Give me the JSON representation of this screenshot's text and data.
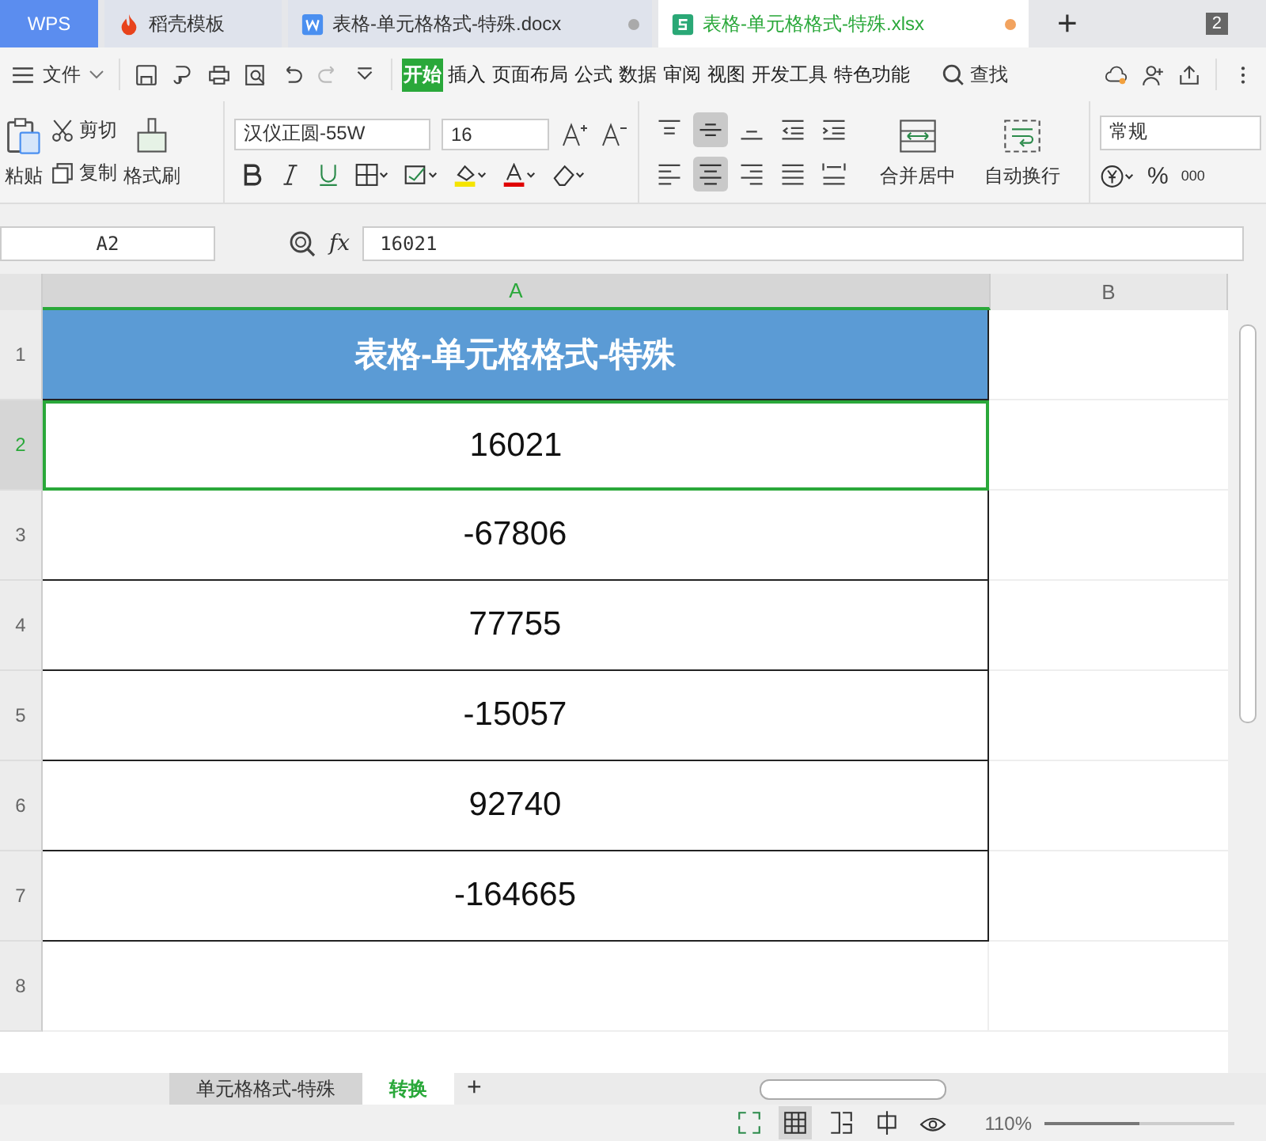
{
  "tabs": [
    {
      "label": "WPS",
      "kind": "app",
      "selected": false
    },
    {
      "label": "稻壳模板",
      "kind": "template",
      "selected": false
    },
    {
      "label": "表格-单元格格式-特殊.docx",
      "kind": "doc",
      "selected": false
    },
    {
      "label": "表格-单元格格式-特殊.xlsx",
      "kind": "sheet",
      "selected": true
    }
  ],
  "new_tab": "+",
  "window_count": "2",
  "menu": {
    "file": "文件",
    "items": [
      {
        "label": "开始",
        "selected": true
      },
      {
        "label": "插入",
        "selected": false
      },
      {
        "label": "页面布局",
        "selected": false
      },
      {
        "label": "公式",
        "selected": false
      },
      {
        "label": "数据",
        "selected": false
      },
      {
        "label": "审阅",
        "selected": false
      },
      {
        "label": "视图",
        "selected": false
      },
      {
        "label": "开发工具",
        "selected": false
      },
      {
        "label": "特色功能",
        "selected": false
      }
    ],
    "search": "查找"
  },
  "ribbon": {
    "paste": "粘贴",
    "cut": "剪切",
    "copy": "复制",
    "format_painter": "格式刷",
    "font": "汉仪正圆-55W",
    "size": "16",
    "merge": "合并居中",
    "wrap": "自动换行",
    "number_format": "常规",
    "number_glyphs": [
      "%",
      "000"
    ]
  },
  "name_box": "A2",
  "formula": "16021",
  "fx": "fx",
  "columns": [
    {
      "label": "A",
      "selected": true
    },
    {
      "label": "B",
      "selected": false
    }
  ],
  "rows": [
    {
      "num": "1",
      "value": "表格-单元格格式-特殊",
      "kind": "header",
      "selected": false
    },
    {
      "num": "2",
      "value": "16021",
      "kind": "value",
      "selected": true
    },
    {
      "num": "3",
      "value": "-67806",
      "kind": "value",
      "selected": false
    },
    {
      "num": "4",
      "value": "77755",
      "kind": "value",
      "selected": false
    },
    {
      "num": "5",
      "value": "-15057",
      "kind": "value",
      "selected": false
    },
    {
      "num": "6",
      "value": "92740",
      "kind": "value",
      "selected": false
    },
    {
      "num": "7",
      "value": "-164665",
      "kind": "value",
      "selected": false
    },
    {
      "num": "8",
      "kind": "empty",
      "selected": false
    }
  ],
  "sheets": [
    {
      "label": "单元格格式-特殊",
      "selected": false
    },
    {
      "label": "转换",
      "selected": true
    }
  ],
  "add_sheet": "+",
  "zoom": "110%",
  "zoom_slider": {
    "level": 0.5
  }
}
